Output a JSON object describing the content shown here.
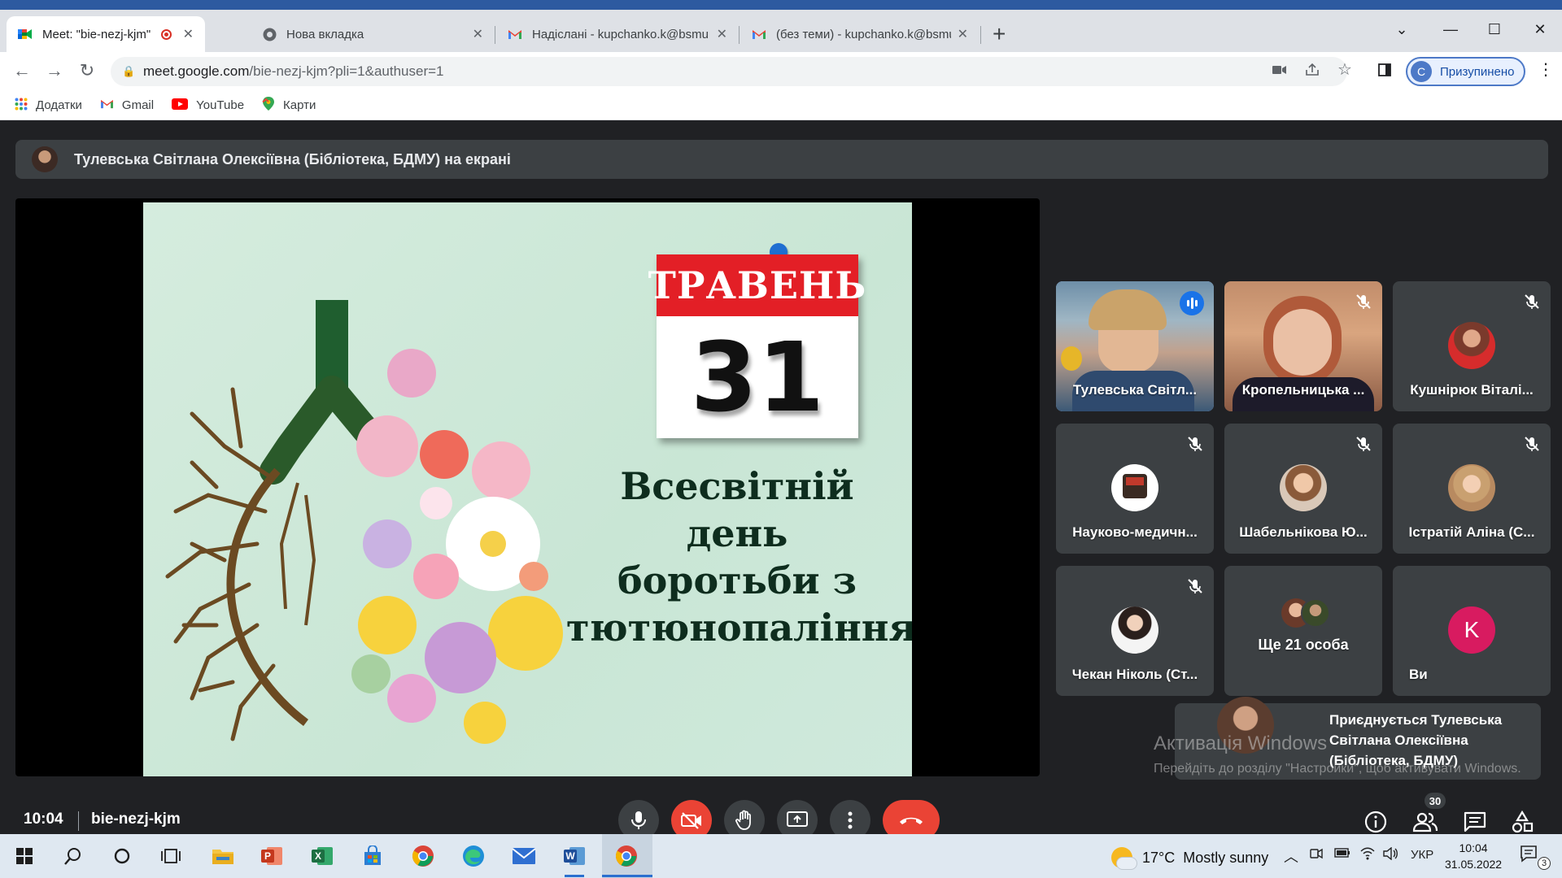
{
  "browser": {
    "tabs": [
      {
        "title": "Meet: \"bie-nezj-kjm\"",
        "active": true
      },
      {
        "title": "Нова вкладка",
        "active": false
      },
      {
        "title": "Надіслані - kupchanko.k@bsmu",
        "active": false
      },
      {
        "title": "(без теми) - kupchanko.k@bsmu",
        "active": false
      }
    ],
    "new_tab_label": "+",
    "address": {
      "host": "meet.google.com",
      "path": "/bie-nezj-kjm?pli=1&authuser=1"
    },
    "profile": {
      "initial": "C",
      "label": "Призупинено"
    },
    "bookmarks": [
      "Додатки",
      "Gmail",
      "YouTube",
      "Карти"
    ],
    "colors": {
      "accent": "#1a73e8",
      "frame": "#dee1e6"
    }
  },
  "meet": {
    "presenter_banner": "Тулевська Світлана Олексіївна (Бібліотека, БДМУ) на екрані",
    "slide": {
      "month": "ТРАВЕНЬ",
      "day": "31",
      "lines": [
        "Всесвітній",
        "день",
        "боротьби з",
        "тютюнопалінням"
      ]
    },
    "participants": [
      {
        "name": "Тулевська Світл...",
        "speaking": true,
        "muted": false
      },
      {
        "name": "Кропельницька ...",
        "speaking": false,
        "muted": true
      },
      {
        "name": "Кушнірюк Віталі...",
        "speaking": false,
        "muted": true
      },
      {
        "name": "Науково-медичн...",
        "speaking": false,
        "muted": true
      },
      {
        "name": "Шабельнікова Ю...",
        "speaking": false,
        "muted": true
      },
      {
        "name": "Істратій Аліна (С...",
        "speaking": false,
        "muted": true
      },
      {
        "name": "Чекан Ніколь (Ст...",
        "speaking": false,
        "muted": true
      },
      {
        "name": "Ще 21 особа",
        "speaking": false,
        "muted": false
      },
      {
        "name": "Ви",
        "speaking": false,
        "muted": false,
        "initial": "K"
      }
    ],
    "join_toast": "Приєднується Тулевська Світлана Олексіївна (Бібліотека, БДМУ)",
    "watermark": {
      "title": "Активація Windows",
      "text": "Перейдіть до розділу \"Настройки\", щоб активувати Windows."
    },
    "time": "10:04",
    "meeting_code": "bie-nezj-kjm",
    "people_count": "30",
    "colors": {
      "end_call": "#ea4335",
      "speaking": "#8ab4f8",
      "you_avatar": "#d81b60"
    }
  },
  "taskbar": {
    "weather": {
      "temp": "17°C",
      "text": "Mostly sunny"
    },
    "language": "УКР",
    "clock_time": "10:04",
    "clock_date": "31.05.2022",
    "notifications": "3"
  }
}
